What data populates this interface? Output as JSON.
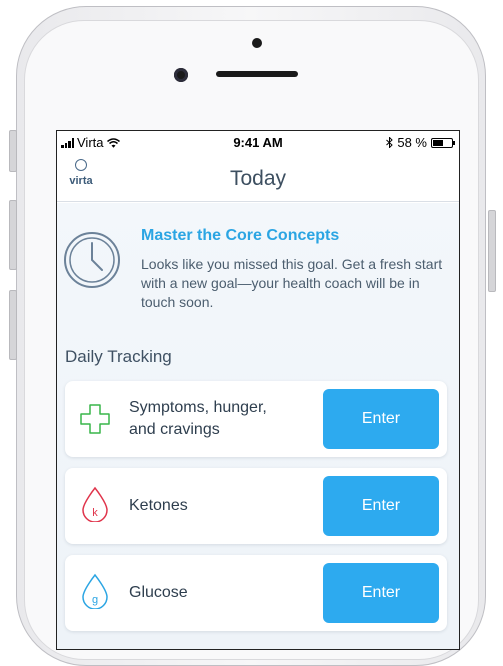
{
  "status_bar": {
    "carrier": "Virta",
    "time": "9:41 AM",
    "battery": "58 %",
    "battery_level": 0.58
  },
  "nav": {
    "logo_text": "virta",
    "title": "Today"
  },
  "goal": {
    "title": "Master the Core Concepts",
    "description": "Looks like you missed this goal. Get a fresh start with a new goal—your health coach will be in touch soon.",
    "icon": "clock-icon"
  },
  "tracking": {
    "section_title": "Daily Tracking",
    "items": [
      {
        "line1": "Symptoms, hunger,",
        "line2": "and cravings",
        "button": "Enter",
        "icon": "plus-icon",
        "color": "#39b54a"
      },
      {
        "line1": "Ketones",
        "line2": "",
        "button": "Enter",
        "icon": "ketone-drop-icon",
        "icon_letter": "k",
        "color": "#e0344b"
      },
      {
        "line1": "Glucose",
        "line2": "",
        "button": "Enter",
        "icon": "glucose-drop-icon",
        "icon_letter": "g",
        "color": "#2ba5e3"
      }
    ]
  },
  "colors": {
    "accent": "#2daaef",
    "goal_title": "#2ba5e3"
  }
}
